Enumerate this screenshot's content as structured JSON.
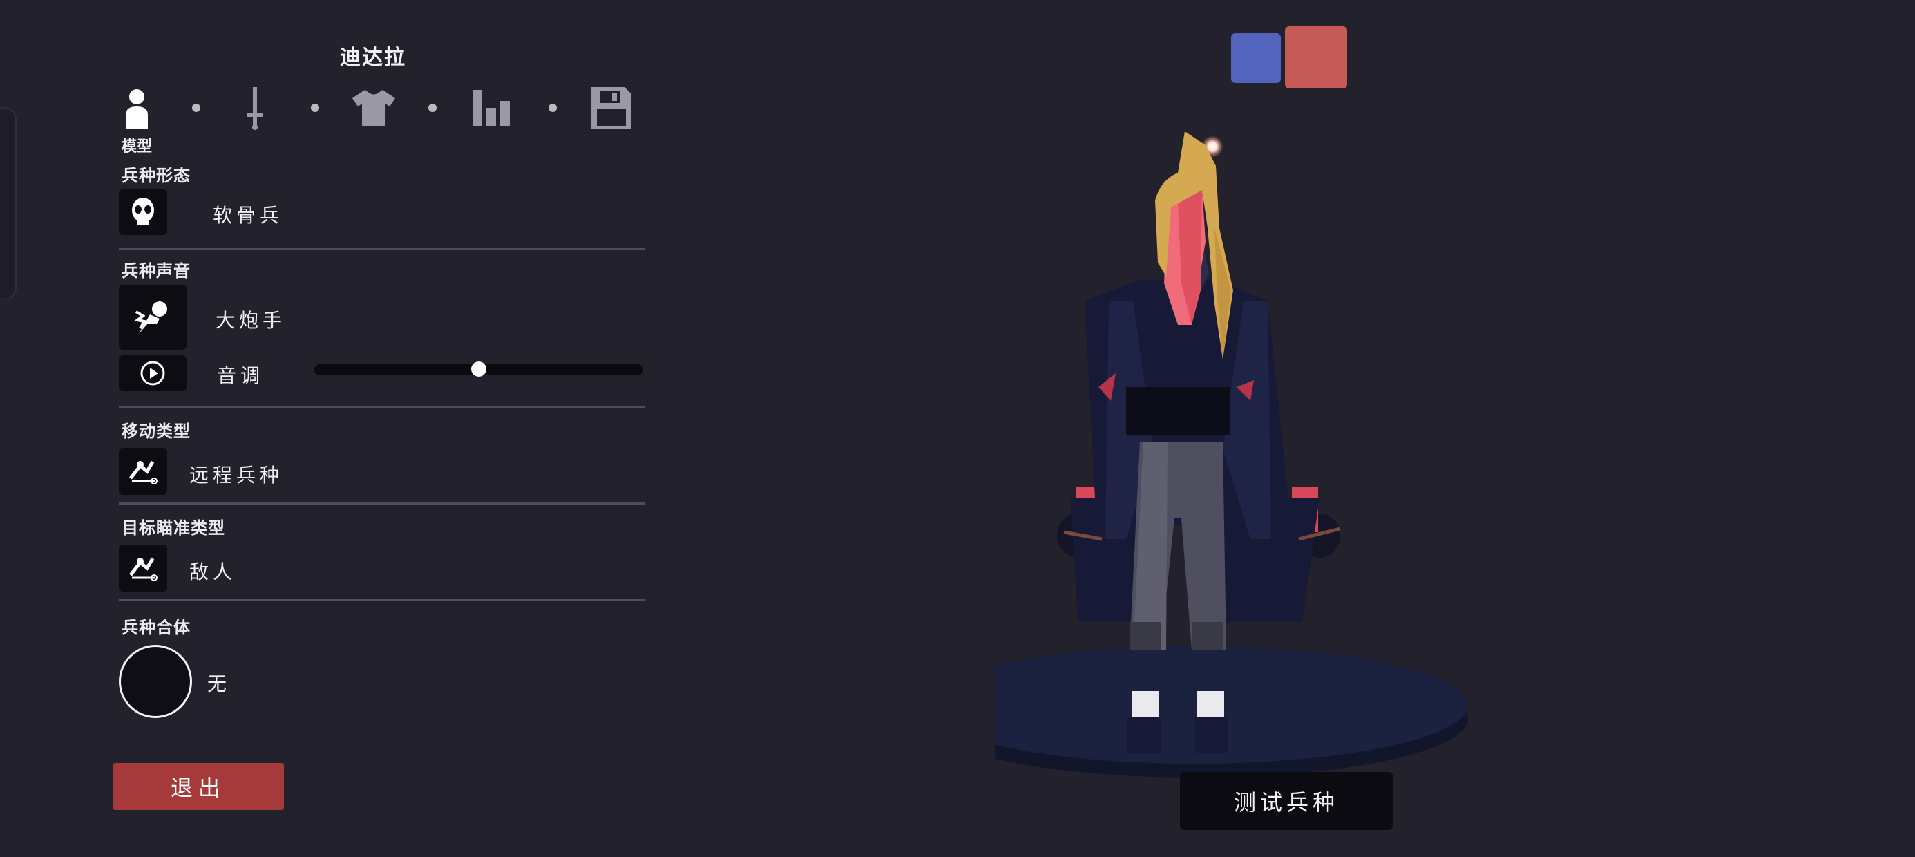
{
  "unit_name": "迪达拉",
  "nav": {
    "active_label": "模型",
    "icons": [
      "person-icon",
      "sword-icon",
      "shirt-icon",
      "stats-icon",
      "save-icon"
    ]
  },
  "sections": {
    "unit_form": {
      "label": "兵种形态",
      "value": "软骨兵",
      "icon": "skull-icon"
    },
    "unit_voice": {
      "label": "兵种声音",
      "value": "大炮手",
      "icon": "cannoneer-icon",
      "pitch_label": "音调",
      "pitch_level": 0.5,
      "play_icon": "play-icon"
    },
    "movement_type": {
      "label": "移动类型",
      "value": "远程兵种",
      "icon": "ranged-unit-icon"
    },
    "targeting_type": {
      "label": "目标瞄准类型",
      "value": "敌人",
      "icon": "target-icon"
    },
    "unit_merge": {
      "label": "兵种合体",
      "value": "无"
    }
  },
  "exit_label": "退出",
  "test_label": "测试兵种",
  "team_colors": {
    "blue": "#5264bd",
    "red": "#c65a57"
  },
  "colors": {
    "accent_red": "#a63a3a",
    "background": "#22212c"
  }
}
